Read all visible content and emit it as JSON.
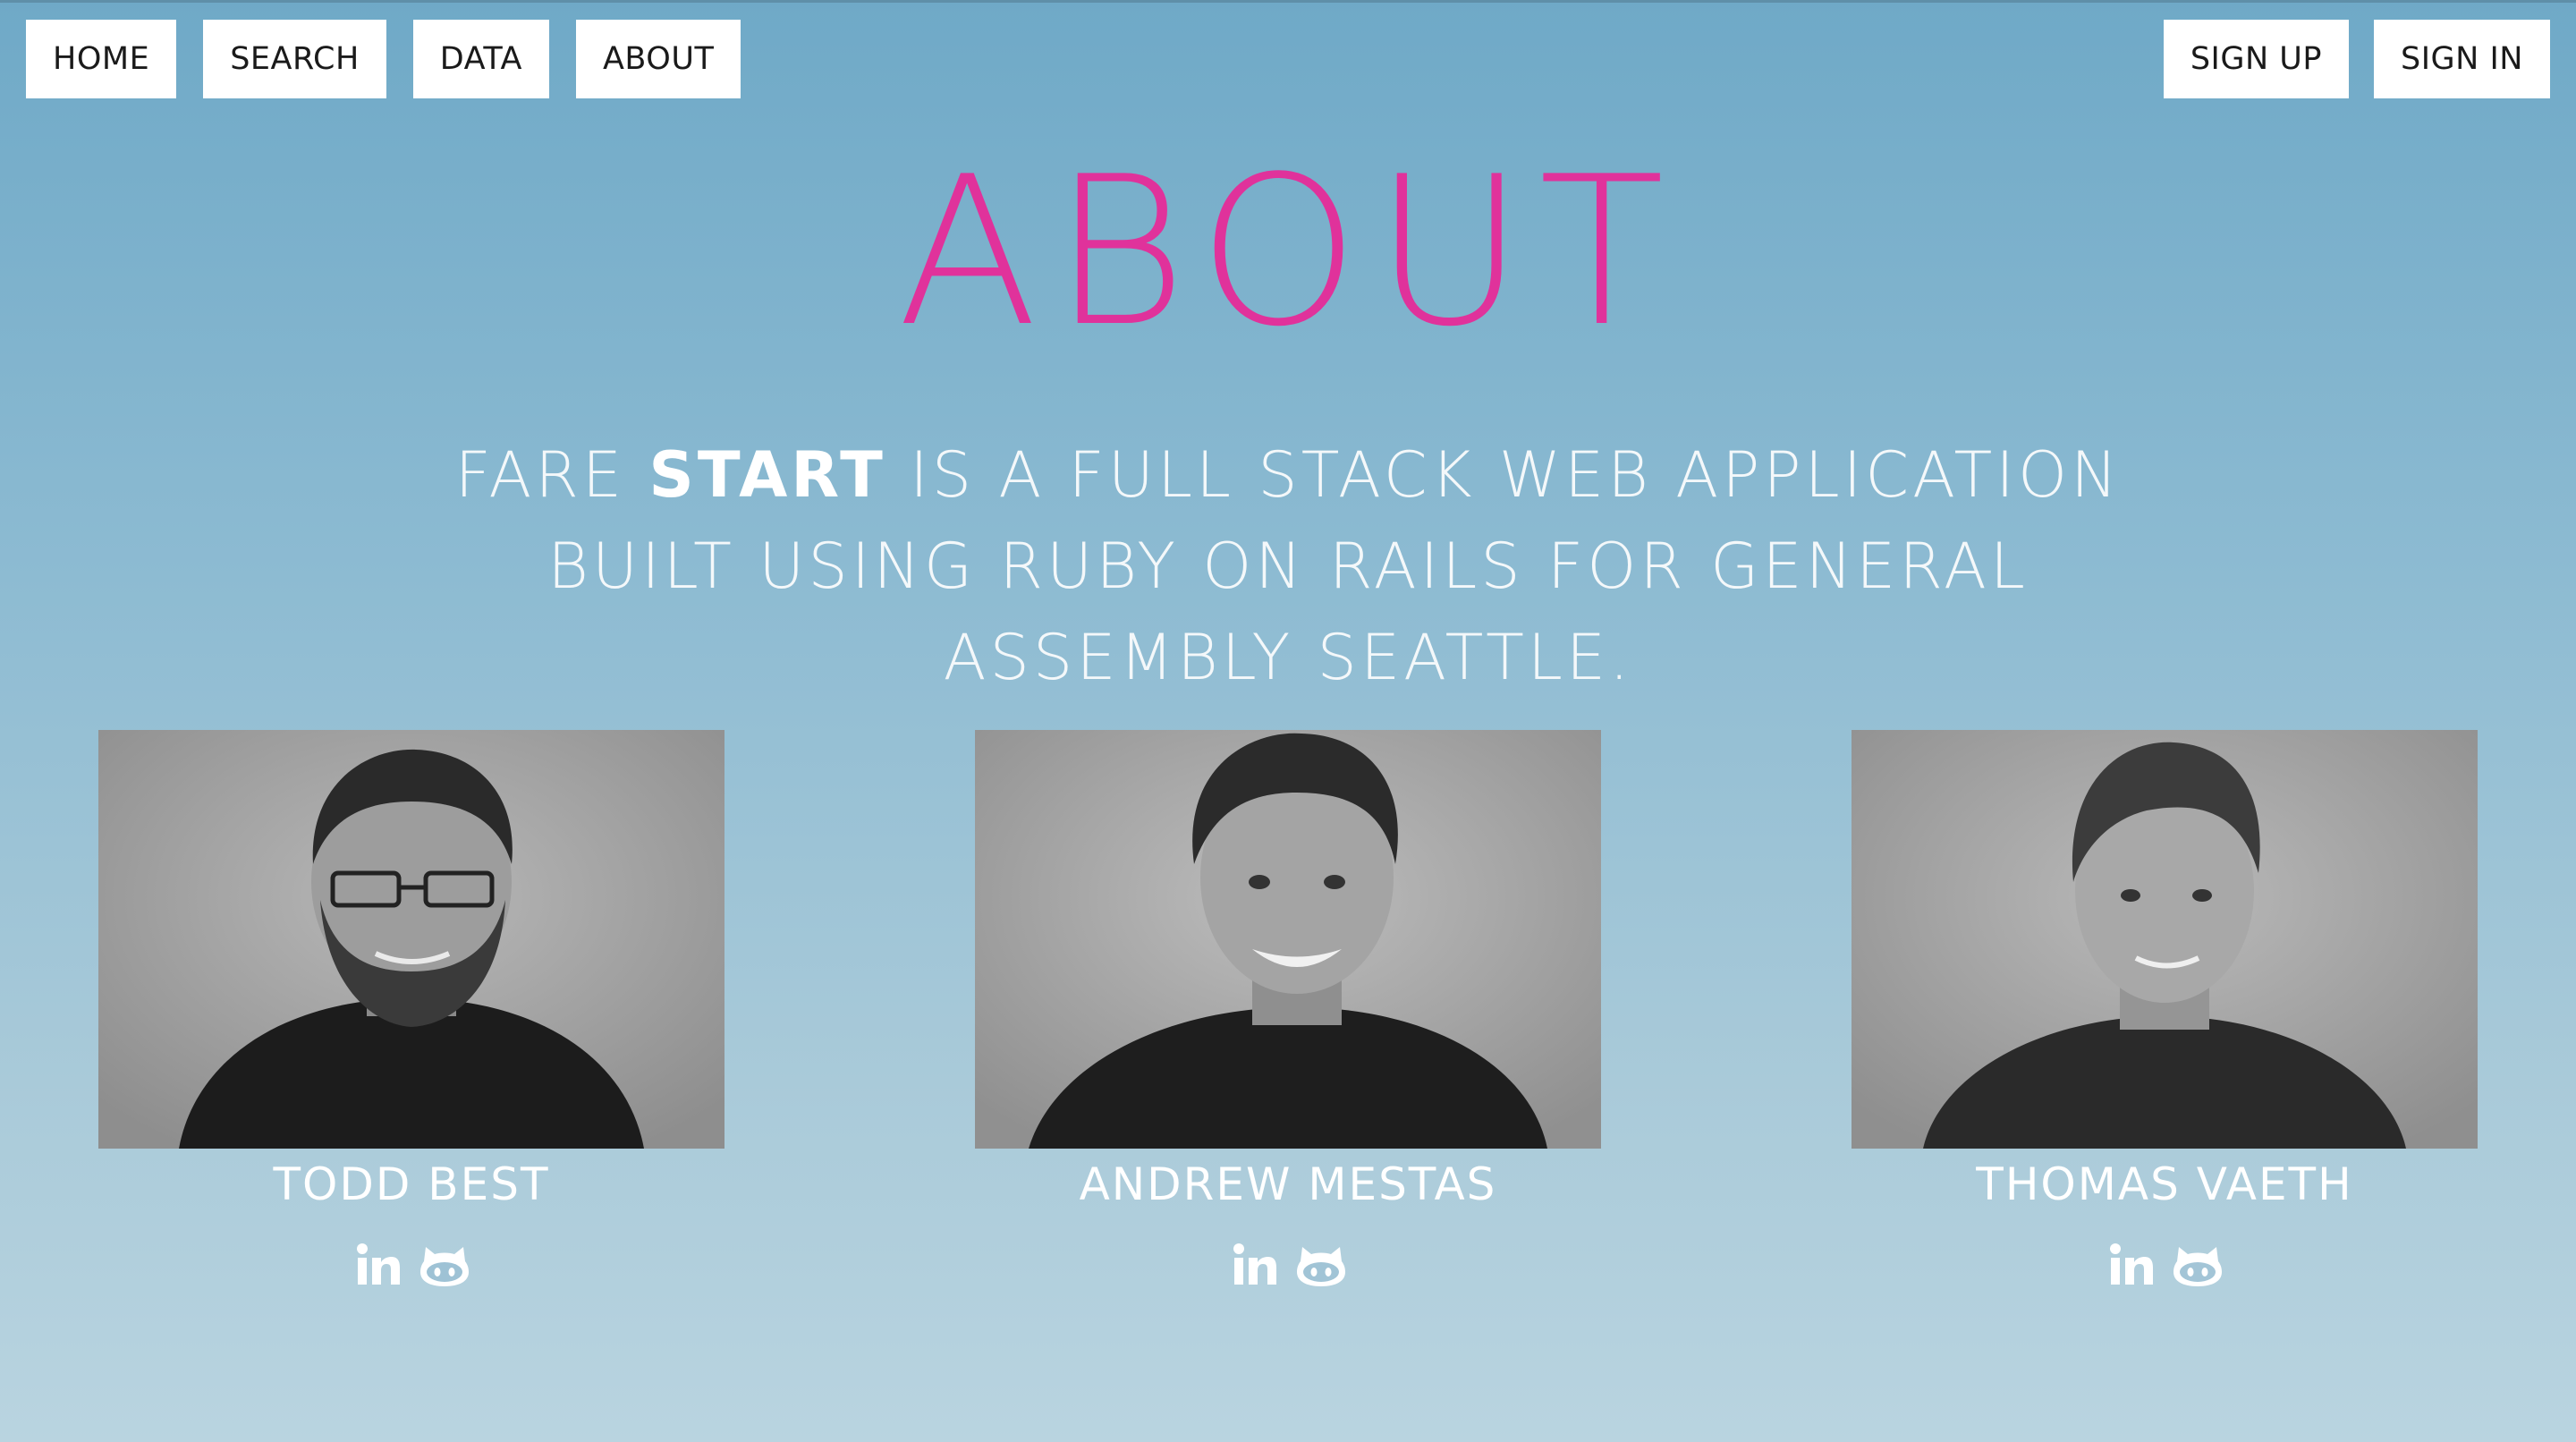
{
  "nav": {
    "left": [
      {
        "label": "HOME"
      },
      {
        "label": "SEARCH"
      },
      {
        "label": "DATA"
      },
      {
        "label": "ABOUT"
      }
    ],
    "right": [
      {
        "label": "SIGN UP"
      },
      {
        "label": "SIGN IN"
      }
    ]
  },
  "page": {
    "title": "ABOUT",
    "tagline": {
      "pre": "FARE ",
      "emphasis": "START",
      "post": " IS A FULL STACK WEB APPLICATION BUILT USING RUBY ON RAILS FOR GENERAL ASSEMBLY SEATTLE."
    }
  },
  "team": [
    {
      "name": "TODD BEST",
      "social": [
        "linkedin-icon",
        "github-icon"
      ]
    },
    {
      "name": "ANDREW MESTAS",
      "social": [
        "linkedin-icon",
        "github-icon"
      ]
    },
    {
      "name": "THOMAS VAETH",
      "social": [
        "linkedin-icon",
        "github-icon"
      ]
    }
  ],
  "colors": {
    "title": "#e0329b",
    "background_top": "#6fa9c7",
    "background_bottom": "#b9d4e0",
    "nav_button": "#ffffff",
    "text_light": "#ffffff"
  }
}
